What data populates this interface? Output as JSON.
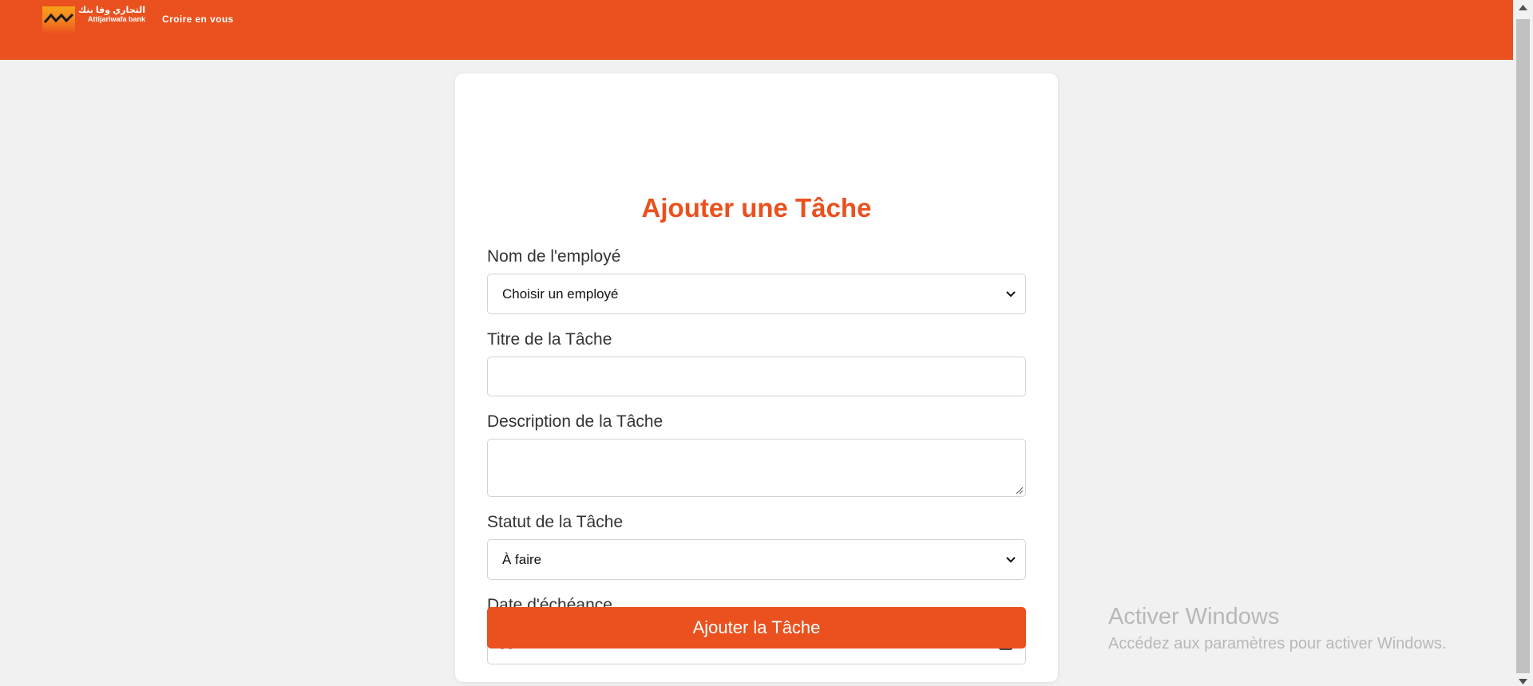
{
  "header": {
    "logo_arabic": "التجاري وفا بنك",
    "logo_latin": "Attijariwafa bank",
    "slogan": "Croire en vous",
    "brand_color": "#ea511e"
  },
  "form": {
    "title": "Ajouter une Tâche",
    "employee_label": "Nom de l'employé",
    "employee_value": "Choisir un employé",
    "task_title_label": "Titre de la Tâche",
    "task_title_value": "",
    "description_label": "Description de la Tâche",
    "description_value": "",
    "status_label": "Statut de la Tâche",
    "status_value": "À faire",
    "due_date_label": "Date d'échéance",
    "due_date_placeholder": "jj/mm/aaaa",
    "submit_label": "Ajouter la Tâche"
  },
  "watermark": {
    "line1": "Activer Windows",
    "line2": "Accédez aux paramètres pour activer Windows."
  },
  "icons": {
    "select_arrow": "chevron-down-icon",
    "date_picker": "calendar-icon",
    "resize": "resize-handle-icon"
  }
}
